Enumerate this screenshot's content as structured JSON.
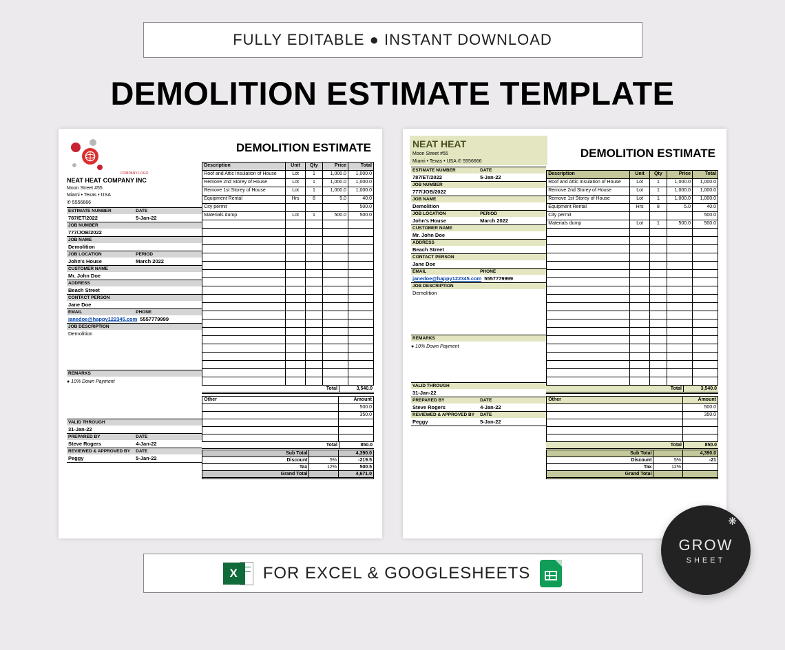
{
  "topBanner": "FULLY EDITABLE ● INSTANT DOWNLOAD",
  "mainTitle": "DEMOLITION ESTIMATE TEMPLATE",
  "bottomBanner": "FOR EXCEL & GOOGLESHEETS",
  "badge": {
    "line1": "GROW",
    "line2": "SHEET"
  },
  "labels": {
    "estimateNumber": "ESTIMATE NUMBER",
    "date": "DATE",
    "jobNumber": "JOB NUMBER",
    "jobName": "JOB NAME",
    "jobLocation": "JOB LOCATION",
    "period": "PERIOD",
    "customerName": "CUSTOMER NAME",
    "address": "ADDRESS",
    "contactPerson": "CONTACT PERSON",
    "email": "EMAIL",
    "phone": "PHONE",
    "jobDescription": "JOB DESCRIPTION",
    "remarks": "REMARKS",
    "validThrough": "VALID THROUGH",
    "preparedBy": "PREPARED BY",
    "reviewedBy": "REVIEWED & APPROVED BY",
    "description": "Description",
    "unit": "Unit",
    "qty": "Qty",
    "price": "Price",
    "total": "Total",
    "other": "Other",
    "amount": "Amount",
    "subTotal": "Sub Total",
    "discount": "Discount",
    "tax": "Tax",
    "grandTotal": "Grand Total"
  },
  "sheet1": {
    "companyLogoText": "COMPANY LOGO",
    "companyName": "NEAT HEAT COMPANY INC",
    "addr1": "Moon Street #55",
    "addr2": "Miami • Texas • USA",
    "addr3": "✆ 5556666",
    "title": "DEMOLITION ESTIMATE",
    "estimateNumber": "787/ET/2022",
    "date": "5-Jan-22",
    "jobNumber": "777/JOB/2022",
    "jobName": "Demolition",
    "jobLocation": "John's House",
    "period": "March 2022",
    "customerName": "Mr. John Doe",
    "address": "Beach Street",
    "contactPerson": "Jane Doe",
    "email": "janedoe@happy122345.com",
    "phone": "5557779999",
    "jobDescription": "Demolition",
    "remark1": "● 10% Down Payment",
    "validThrough": "31-Jan-22",
    "preparedBy": "Steve Rogers",
    "preparedDate": "4-Jan-22",
    "reviewedBy": "Peggy",
    "reviewedDate": "5-Jan-22",
    "items": [
      {
        "desc": "Roof and Attic Insulation of House",
        "unit": "Lot",
        "qty": "1",
        "price": "1,000.0",
        "total": "1,000.0"
      },
      {
        "desc": "Remove 2nd Storey of House",
        "unit": "Lot",
        "qty": "1",
        "price": "1,000.0",
        "total": "1,000.0"
      },
      {
        "desc": "Remove 1st Storey of House",
        "unit": "Lot",
        "qty": "1",
        "price": "1,000.0",
        "total": "1,000.0"
      },
      {
        "desc": "Equipment Rental",
        "unit": "Hrs",
        "qty": "8",
        "price": "5.0",
        "total": "40.0"
      },
      {
        "desc": "City permit",
        "unit": "",
        "qty": "",
        "price": "",
        "total": "500.0"
      },
      {
        "desc": "Materials dump",
        "unit": "Lot",
        "qty": "1",
        "price": "500.0",
        "total": "500.0"
      }
    ],
    "itemsTotal": "3,540.0",
    "other": [
      {
        "amt": "500.0"
      },
      {
        "amt": "350.0"
      }
    ],
    "otherTotal": "850.0",
    "subTotal": "4,390.0",
    "discountPct": "5%",
    "discountAmt": "-219.5",
    "taxPct": "12%",
    "taxAmt": "500.5",
    "grandTotal": "4,671.0"
  },
  "sheet2": {
    "companyName": "NEAT HEAT",
    "addr1": "Moon Street #55",
    "addr2": "Miami • Texas • USA ✆ 5556666",
    "title": "DEMOLITION ESTIMATE",
    "estimateNumber": "787/ET/2022",
    "date": "5-Jan-22",
    "jobNumber": "777/JOB/2022",
    "jobName": "Demolition",
    "jobLocation": "John's House",
    "period": "March 2022",
    "customerName": "Mr. John Doe",
    "address": "Beach Street",
    "contactPerson": "Jane Doe",
    "email": "janedoe@happy122345.com",
    "phone": "5557779999",
    "jobDescription": "Demolition",
    "remark1": "● 10% Down Payment",
    "validThrough": "31-Jan-22",
    "preparedBy": "Steve Rogers",
    "preparedDate": "4-Jan-22",
    "reviewedBy": "Peggy",
    "reviewedDate": "5-Jan-22",
    "itemsTotal": "3,540.0",
    "otherTotal": "850.0",
    "subTotal": "4,390.0",
    "discountPct": "5%",
    "discountAmt": "-21",
    "taxPct": "12%",
    "grandTotal": ""
  }
}
